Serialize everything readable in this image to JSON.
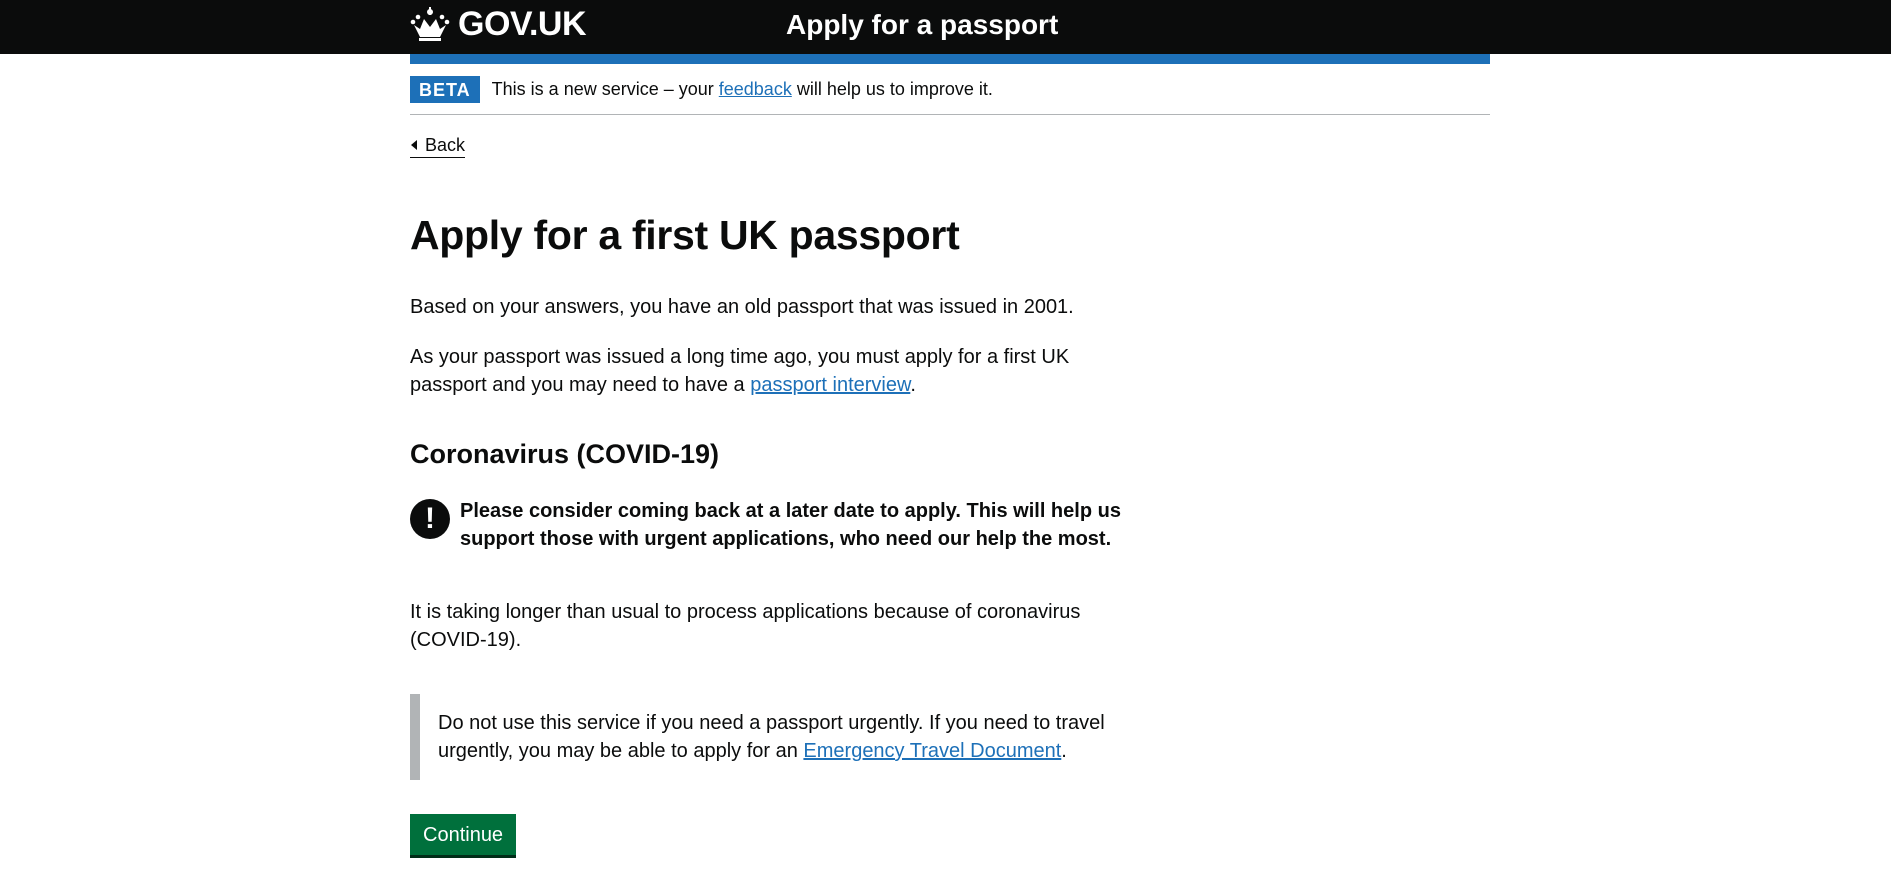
{
  "header": {
    "logo_text": "GOV.UK",
    "service_name": "Apply for a passport"
  },
  "phase_banner": {
    "tag": "BETA",
    "text_before": "This is a new service – your ",
    "link_text": "feedback",
    "text_after": " will help us to improve it."
  },
  "back_link": "Back",
  "main": {
    "title": "Apply for a first UK passport",
    "para1": "Based on your answers, you have an old passport that was issued in 2001.",
    "para2_before": "As your passport was issued a long time ago, you must apply for a first UK passport and you may need to have a ",
    "para2_link": "passport interview",
    "para2_after": ".",
    "covid_heading": "Coronavirus (COVID-19)",
    "warning_icon": "!",
    "warning_text": "Please consider coming back at a later date to apply. This will help us support those with urgent applications, who need our help the most.",
    "para3": "It is taking longer than usual to process applications because of coronavirus (COVID-19).",
    "inset_before": "Do not use this service if you need a passport urgently. If you need to travel urgently, you may be able to apply for an ",
    "inset_link": "Emergency Travel Document",
    "inset_after": ".",
    "continue_label": "Continue"
  },
  "colors": {
    "header_bg": "#0b0c0c",
    "brand_blue": "#1d70b8",
    "button_green": "#00703c",
    "inset_border": "#b1b4b6"
  },
  "icons": [
    "crown-icon",
    "back-chevron-icon",
    "warning-icon"
  ]
}
